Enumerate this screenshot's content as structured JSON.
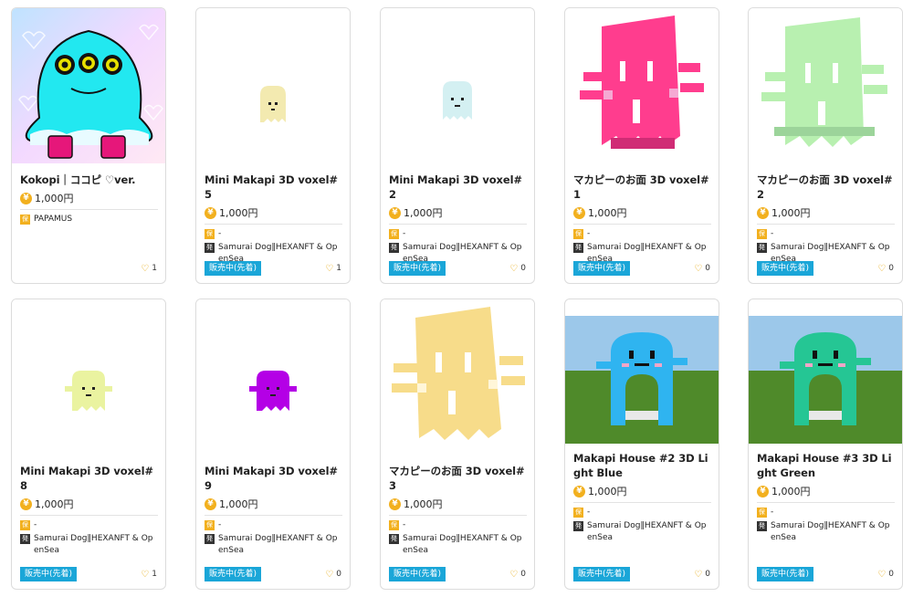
{
  "labels": {
    "owner_badge": "保",
    "issuer_badge": "発",
    "coin": "¥",
    "heart": "♡"
  },
  "cards": [
    {
      "title": "Kokopi｜ココピ ♡ver.",
      "price": "1,000円",
      "owner": "PAPAMUS",
      "issuer": "",
      "status": "",
      "likes": "1",
      "image": "kokopi-illustration"
    },
    {
      "title": "Mini Makapi 3D voxel#5",
      "price": "1,000円",
      "owner": "-",
      "issuer": "Samurai Dog‖HEXANFT & OpenSea",
      "status": "販売中(先着)",
      "likes": "1",
      "image": "mini-voxel-yellow"
    },
    {
      "title": "Mini Makapi 3D voxel#2",
      "price": "1,000円",
      "owner": "-",
      "issuer": "Samurai Dog‖HEXANFT & OpenSea",
      "status": "販売中(先着)",
      "likes": "0",
      "image": "mini-voxel-lightblue"
    },
    {
      "title": "マカピーのお面 3D voxel#1",
      "price": "1,000円",
      "owner": "-",
      "issuer": "Samurai Dog‖HEXANFT & OpenSea",
      "status": "販売中(先着)",
      "likes": "0",
      "image": "mask-voxel-pink"
    },
    {
      "title": "マカピーのお面 3D voxel#2",
      "price": "1,000円",
      "owner": "-",
      "issuer": "Samurai Dog‖HEXANFT & OpenSea",
      "status": "販売中(先着)",
      "likes": "0",
      "image": "mask-voxel-green"
    },
    {
      "title": "Mini Makapi 3D voxel#8",
      "price": "1,000円",
      "owner": "-",
      "issuer": "Samurai Dog‖HEXANFT & OpenSea",
      "status": "販売中(先着)",
      "likes": "1",
      "image": "mini-voxel-lime"
    },
    {
      "title": "Mini Makapi 3D voxel#9",
      "price": "1,000円",
      "owner": "-",
      "issuer": "Samurai Dog‖HEXANFT & OpenSea",
      "status": "販売中(先着)",
      "likes": "0",
      "image": "mini-voxel-purple"
    },
    {
      "title": "マカピーのお面 3D voxel#3",
      "price": "1,000円",
      "owner": "-",
      "issuer": "Samurai Dog‖HEXANFT & OpenSea",
      "status": "販売中(先着)",
      "likes": "0",
      "image": "mask-voxel-yellow"
    },
    {
      "title": "Makapi House #2 3D Light Blue",
      "price": "1,000円",
      "owner": "-",
      "issuer": "Samurai Dog‖HEXANFT & OpenSea",
      "status": "販売中(先着)",
      "likes": "0",
      "image": "house-voxel-blue"
    },
    {
      "title": "Makapi House #3 3D Light Green",
      "price": "1,000円",
      "owner": "-",
      "issuer": "Samurai Dog‖HEXANFT & OpenSea",
      "status": "販売中(先着)",
      "likes": "0",
      "image": "house-voxel-green"
    }
  ],
  "colors": {
    "status_bg": "#1aa6d8",
    "coin": "#f2b01e",
    "heart": "#e4a400",
    "kokopi": "#22e8f0",
    "pink": "#ff3d8e",
    "green": "#b8f0b0",
    "yellow": "#f7dc8a",
    "lightblue": "#cdeef0",
    "lime": "#eaf3a0",
    "purple": "#b400e6",
    "sky": "#9cc8ea",
    "grass": "#4f8a2a",
    "houseblue": "#2fb4f0",
    "housegreen": "#25c694"
  }
}
